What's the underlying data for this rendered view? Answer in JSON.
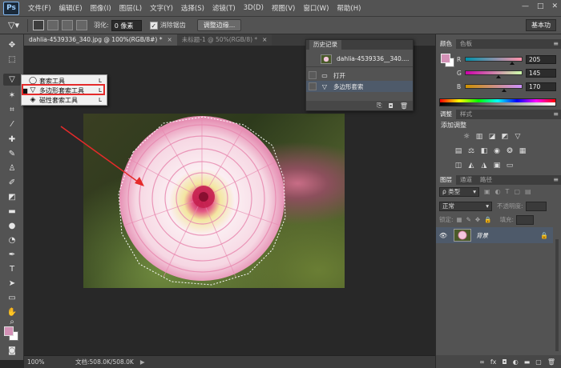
{
  "menubar": {
    "logo": "Ps",
    "items": [
      "文件(F)",
      "编辑(E)",
      "图像(I)",
      "图层(L)",
      "文字(Y)",
      "选择(S)",
      "滤镜(T)",
      "3D(D)",
      "视图(V)",
      "窗口(W)",
      "帮助(H)"
    ],
    "window_controls": [
      "—",
      "□",
      "✕"
    ]
  },
  "options": {
    "feather_label": "羽化:",
    "feather_value": "0 像素",
    "antialias_label": "消除锯齿",
    "refine_edge": "调整边缘...",
    "workspace": "基本功"
  },
  "tabs": [
    {
      "label": "dahlia-4539336_340.jpg @ 100%(RGB/8#) *",
      "active": true
    },
    {
      "label": "未标题-1 @ 50%(RGB/8) *",
      "active": false
    }
  ],
  "flyout": {
    "items": [
      {
        "icon": "◯",
        "label": "套索工具",
        "key": "L",
        "selected": false
      },
      {
        "icon": "▽",
        "label": "多边形套索工具",
        "key": "L",
        "selected": true
      },
      {
        "icon": "◈",
        "label": "磁性套索工具",
        "key": "L",
        "selected": false
      }
    ]
  },
  "history": {
    "title": "历史记录",
    "snapshot": "dahlia-4539336__340....",
    "rows": [
      {
        "icon": "▭",
        "label": "打开",
        "selected": false
      },
      {
        "icon": "▽",
        "label": "多边形套索",
        "selected": true
      }
    ]
  },
  "status": {
    "zoom": "100%",
    "docinfo": "文档:508.0K/508.0K",
    "arrow": "▶"
  },
  "color_panel": {
    "tabs": [
      "颜色",
      "色板"
    ],
    "fg": "#d391b6",
    "bg": "#ffffff",
    "channels": [
      {
        "label": "R",
        "value": "205",
        "pos": 0.8
      },
      {
        "label": "G",
        "value": "145",
        "pos": 0.57
      },
      {
        "label": "B",
        "value": "170",
        "pos": 0.67
      }
    ]
  },
  "adjustments": {
    "tabs": [
      "调整",
      "样式"
    ],
    "title": "添加调整"
  },
  "layers": {
    "tabs": [
      "图层",
      "通道",
      "路径"
    ],
    "filter": "ρ 类型",
    "blend": "正常",
    "opacity_label": "不透明度:",
    "lock_label": "锁定:",
    "fill_label": "填充:",
    "layer_name": "背景"
  }
}
